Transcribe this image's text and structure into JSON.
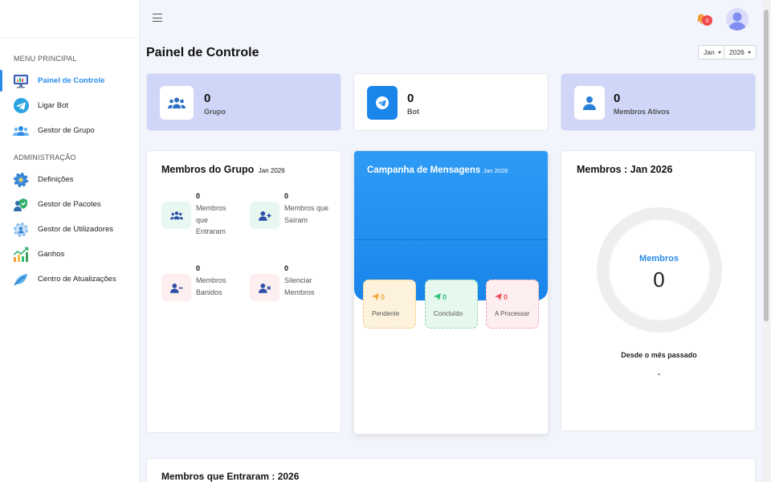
{
  "sidebar": {
    "section_main": "MENU PRINCIPAL",
    "items_main": [
      {
        "label": "Painel de Controle",
        "icon": "dashboard-icon",
        "active": true
      },
      {
        "label": "Ligar Bot",
        "icon": "telegram-icon"
      },
      {
        "label": "Gestor de Grupo",
        "icon": "group-icon"
      }
    ],
    "section_admin": "ADMINISTRAÇÃO",
    "items_admin": [
      {
        "label": "Definições",
        "icon": "settings-gear-icon"
      },
      {
        "label": "Gestor de Pacotes",
        "icon": "package-manager-icon"
      },
      {
        "label": "Gestor de Utilizadores",
        "icon": "user-manager-gear-icon"
      },
      {
        "label": "Ganhos",
        "icon": "earnings-chart-icon"
      },
      {
        "label": "Centro de Atualizações",
        "icon": "updates-leaf-icon"
      }
    ]
  },
  "topbar": {
    "notification_count": "0"
  },
  "page": {
    "title": "Painel de Controle",
    "month": "Jan",
    "year": "2026"
  },
  "stats": [
    {
      "value": "0",
      "label": "Grupo",
      "icon": "users-icon"
    },
    {
      "value": "0",
      "label": "Bot",
      "icon": "telegram-icon"
    },
    {
      "value": "0",
      "label": "Membros Ativos",
      "icon": "user-icon"
    }
  ],
  "group_members": {
    "title": "Membros do Grupo",
    "period": "Jan 2026",
    "items": [
      {
        "value": "0",
        "label": "Membros que Entraram",
        "icon": "users-icon"
      },
      {
        "value": "0",
        "label": "Membros que Saíram",
        "icon": "user-plus-icon"
      },
      {
        "value": "0",
        "label": "Membros Banidos",
        "icon": "user-minus-icon"
      },
      {
        "value": "0",
        "label": "Silenciar Membros",
        "icon": "user-times-icon"
      }
    ]
  },
  "campaign": {
    "title": "Campanha de Mensagens",
    "period": "Jan 2026",
    "statuses": [
      {
        "value": "0",
        "label": "Pendente",
        "color": "#f2a93b"
      },
      {
        "value": "0",
        "label": "Concluído",
        "color": "#2fc279"
      },
      {
        "value": "0",
        "label": "A Processar",
        "color": "#ee4d5c"
      }
    ]
  },
  "members_month": {
    "title": "Membros : Jan 2026",
    "ring_label": "Membros",
    "ring_value": "0",
    "since_label": "Desde o mês passado",
    "since_value": "-"
  },
  "bottom": {
    "title": "Membros que Entraram : 2026"
  },
  "colors": {
    "accent": "#2a8ce8",
    "stat_bg": "#cfd6f8",
    "badge": "#f0494a"
  }
}
